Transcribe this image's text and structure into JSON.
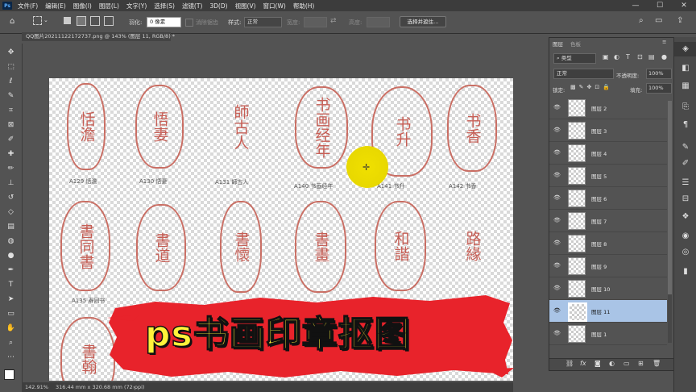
{
  "app": {
    "logo": "Ps"
  },
  "menu": [
    "文件(F)",
    "编辑(E)",
    "图像(I)",
    "图层(L)",
    "文字(Y)",
    "选择(S)",
    "滤镜(T)",
    "3D(D)",
    "视图(V)",
    "窗口(W)",
    "帮助(H)"
  ],
  "window_controls": {
    "minimize": "—",
    "maximize": "☐",
    "close": "✕"
  },
  "options": {
    "feather_label": "羽化:",
    "feather_value": "0 像素",
    "antialias_label": "消除锯齿",
    "style_label": "样式:",
    "style_value": "正常",
    "width_label": "宽度:",
    "height_label": "高度:",
    "select_mask_button": "选择并遮住..."
  },
  "document_tab": "QQ图片20211122172737.png @ 143% (图层 11, RGB/8) *",
  "status": {
    "zoom": "142.91%",
    "size": "316.44 mm x 320.68 mm (72 ppi)"
  },
  "seals": {
    "row1": [
      {
        "glyph": "恬澹",
        "caption": "A129 恬澹"
      },
      {
        "glyph": "悟妻",
        "caption": "A130 悟妻"
      },
      {
        "glyph": "師古人",
        "caption": "A131 師古人"
      },
      {
        "glyph": "书画经年",
        "caption": "A140 书画经年"
      },
      {
        "glyph": "书升",
        "caption": "A141 书升"
      },
      {
        "glyph": "书香",
        "caption": "A142 书香"
      }
    ],
    "row2": [
      {
        "glyph": "書同書"
      },
      {
        "glyph": "書道"
      },
      {
        "glyph": "書懷"
      },
      {
        "glyph": "書畫"
      },
      {
        "glyph": "和諧"
      },
      {
        "glyph": "路緣"
      }
    ],
    "row2_caption": "A135 寿同书",
    "row3": [
      {
        "glyph": "書翰"
      }
    ]
  },
  "banner": {
    "text": "ps书画印章抠图"
  },
  "layers_panel": {
    "tabs": [
      "图层",
      "色板"
    ],
    "filter_kind": "类型",
    "blend_mode": "正常",
    "opacity_label": "不透明度:",
    "opacity_value": "100%",
    "lock_label": "锁定:",
    "fill_label": "填充:",
    "fill_value": "100%",
    "layers": [
      {
        "name": "图层 2",
        "selected": false
      },
      {
        "name": "图层 3",
        "selected": false
      },
      {
        "name": "图层 4",
        "selected": false
      },
      {
        "name": "图层 5",
        "selected": false
      },
      {
        "name": "图层 6",
        "selected": false
      },
      {
        "name": "图层 7",
        "selected": false
      },
      {
        "name": "图层 8",
        "selected": false
      },
      {
        "name": "图层 9",
        "selected": false
      },
      {
        "name": "图层 10",
        "selected": false
      },
      {
        "name": "图层 11",
        "selected": true
      },
      {
        "name": "图层 1",
        "selected": false
      }
    ]
  },
  "colors": {
    "seal_red": "#c45a4e",
    "banner_red": "#e8232b",
    "banner_text": "#fff23a",
    "selected_layer": "#a9c4e6"
  }
}
